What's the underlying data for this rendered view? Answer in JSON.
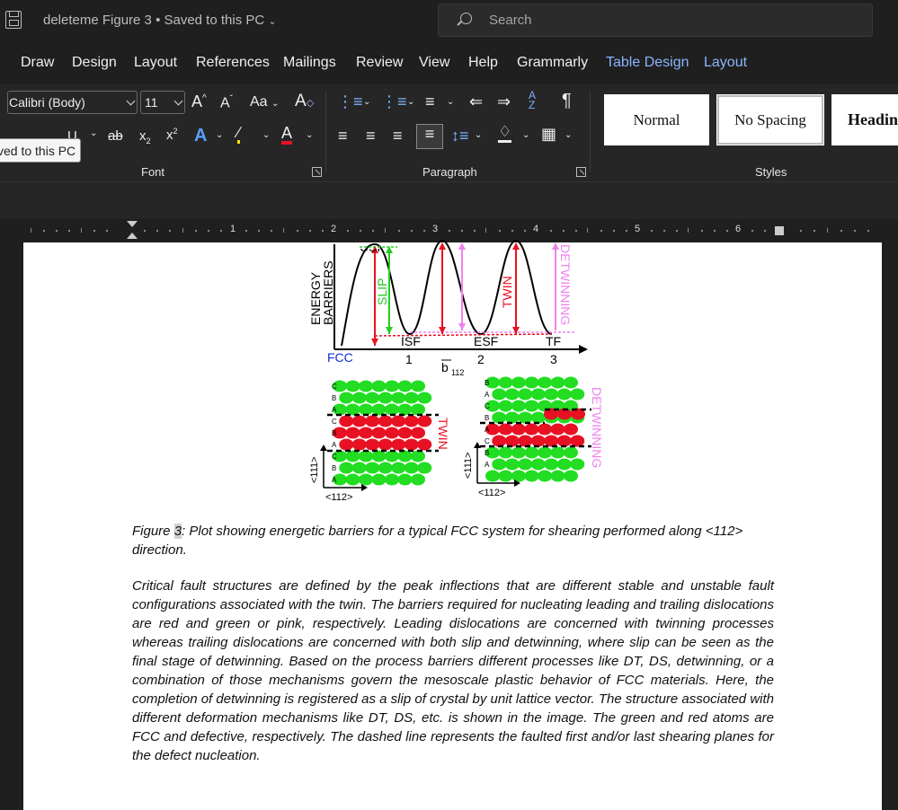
{
  "titlebar": {
    "doc_title": "deleteme Figure 3 • Saved to this PC",
    "search_placeholder": "Search"
  },
  "menu": [
    "Draw",
    "Design",
    "Layout",
    "References",
    "Mailings",
    "Review",
    "View",
    "Help",
    "Grammarly",
    "Table Design",
    "Layout"
  ],
  "ribbon": {
    "font_name": "Calibri (Body)",
    "font_size": "11",
    "change_case": "Aa",
    "groups": {
      "font": "Font",
      "paragraph": "Paragraph",
      "styles": "Styles"
    },
    "styles": [
      "Normal",
      "No Spacing",
      "Headin"
    ],
    "tooltip": "ved to this PC"
  },
  "ruler": {
    "numbers": [
      "1",
      "2",
      "3",
      "4",
      "5",
      "6"
    ]
  },
  "figure": {
    "y_label_1": "ENERGY",
    "y_label_2": "BARRIERS",
    "x_origin": "FCC",
    "states": [
      "ISF",
      "ESF",
      "TF"
    ],
    "ticks": [
      "1",
      "2",
      "3"
    ],
    "x_label": "b",
    "x_label_sub": "112",
    "top_label": "USF",
    "slip": "SLIP",
    "twin": "TWIN",
    "detwinning": "DETWINNING",
    "twin_left": "TWIN",
    "detwin_right": "DETWINNING",
    "axis_111": "<111>",
    "axis_112": "<112>",
    "stack_letters_left": [
      "C",
      "B",
      "A",
      "C",
      "B",
      "A",
      "C",
      "B",
      "A"
    ],
    "stack_letters_right": [
      "B",
      "A",
      "C",
      "B",
      "A",
      "C",
      "B",
      "A"
    ]
  },
  "document": {
    "caption_prefix": "Figure ",
    "caption_num": "3",
    "caption_rest": ": Plot showing energetic barriers for a typical FCC system for shearing performed along <112> direction.",
    "paragraph": " Critical fault structures are defined by the peak inflections that are different stable and unstable fault configurations associated with the twin. The barriers required for nucleating leading and trailing dislocations are red and green or pink, respectively. Leading dislocations are concerned with twinning processes whereas trailing dislocations are concerned with both slip and detwinning, where slip can be seen as the final stage of detwinning. Based on the process barriers different processes like DT, DS, detwinning, or a combination of those mechanisms govern the mesoscale plastic behavior of FCC materials. Here, the completion of detwinning is registered as a slip of crystal by unit lattice vector. The structure associated with different deformation mechanisms like DT, DS, etc. is shown in the image. The green and red atoms are FCC and defective, respectively. The dashed line represents the faulted first and/or last shearing planes for the defect nucleation."
  }
}
